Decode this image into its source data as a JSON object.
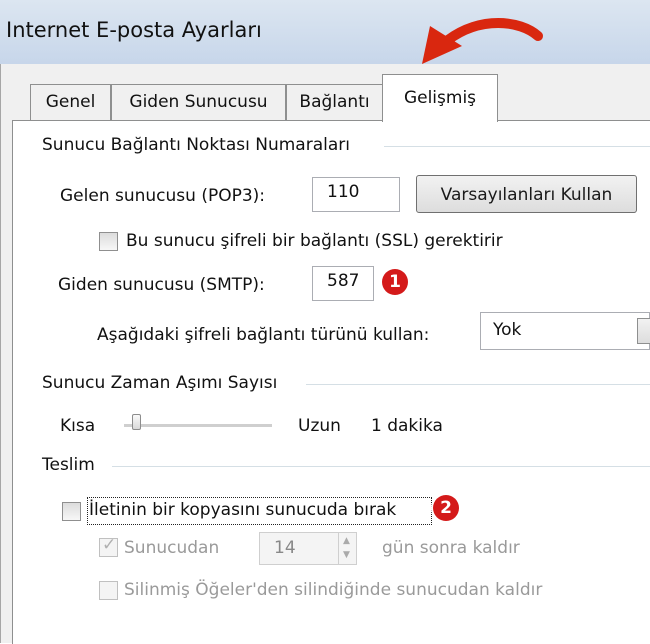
{
  "window": {
    "title": "Internet E-posta Ayarları"
  },
  "tabs": [
    {
      "label": "Genel"
    },
    {
      "label": "Giden Sunucusu"
    },
    {
      "label": "Bağlantı"
    },
    {
      "label": "Gelişmiş",
      "active": true
    }
  ],
  "ports": {
    "legend": "Sunucu Bağlantı Noktası Numaraları",
    "incoming_label": "Gelen sunucusu (POP3):",
    "incoming_value": "110",
    "defaults_button": "Varsayılanları Kullan",
    "ssl_checkbox": "Bu sunucu şifreli bir bağlantı (SSL) gerektirir",
    "ssl_checked": false,
    "outgoing_label": "Giden sunucusu (SMTP):",
    "outgoing_value": "587",
    "badge1": "1",
    "encryption_label": "Aşağıdaki şifreli bağlantı türünü kullan:",
    "encryption_value": "Yok"
  },
  "timeout": {
    "legend": "Sunucu Zaman Aşımı Sayısı",
    "short_label": "Kısa",
    "long_label": "Uzun",
    "value": "1 dakika",
    "level": 0.05
  },
  "delivery": {
    "legend": "Teslim",
    "leave_copy": "İletinin bir kopyasını sunucuda bırak",
    "leave_copy_checked": false,
    "badge2": "2",
    "remove_after_prefix": "Sunucudan",
    "remove_after_days": "14",
    "remove_after_suffix": "gün sonra kaldır",
    "remove_after_checked": true,
    "remove_deleted": "Silinmiş Öğeler'den silindiğinde sunucudan kaldır",
    "remove_deleted_checked": false
  },
  "colors": {
    "badge": "#d41a1a",
    "title_bar": "#c7d6ea",
    "arrow": "#d9270f"
  }
}
